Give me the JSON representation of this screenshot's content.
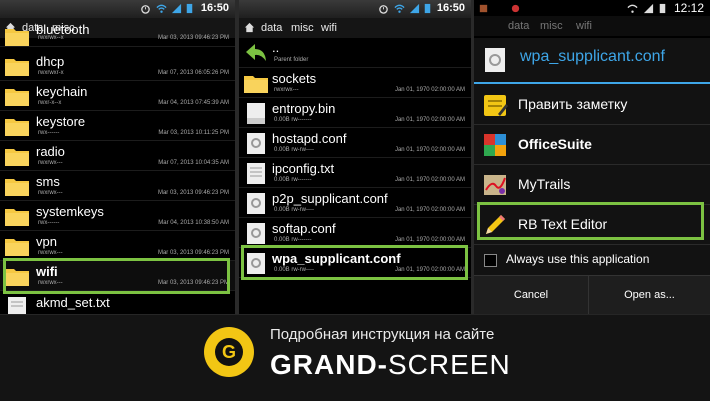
{
  "panel1": {
    "time": "16:50",
    "breadcrumbs": [
      "data",
      "misc"
    ],
    "files": [
      {
        "name": "bluetooth",
        "perm": "rwxrwx--x",
        "date": "Mar 03, 2013 09:46:23 PM"
      },
      {
        "name": "dhcp",
        "perm": "rwxrwxr-x",
        "date": "Mar 07, 2013 06:05:26 PM"
      },
      {
        "name": "keychain",
        "perm": "rwxr-x--x",
        "date": "Mar 04, 2013 07:45:39 AM"
      },
      {
        "name": "keystore",
        "perm": "rwx------",
        "date": "Mar 03, 2013 10:11:25 PM"
      },
      {
        "name": "radio",
        "perm": "rwxrwx---",
        "date": "Mar 07, 2013 10:04:35 AM"
      },
      {
        "name": "sms",
        "perm": "rwxrwx---",
        "date": "Mar 03, 2013 09:46:23 PM"
      },
      {
        "name": "systemkeys",
        "perm": "rwx------",
        "date": "Mar 04, 2013 10:38:50 AM"
      },
      {
        "name": "vpn",
        "perm": "rwxrwx---",
        "date": "Mar 03, 2013 09:46:23 PM"
      },
      {
        "name": "wifi",
        "perm": "rwxrwx---",
        "date": "Mar 03, 2013 09:46:23 PM"
      },
      {
        "name": "akmd_set.txt",
        "perm": "",
        "date": ""
      }
    ]
  },
  "panel2": {
    "time": "16:50",
    "breadcrumbs": [
      "data",
      "misc",
      "wifi"
    ],
    "parent": {
      "name": "..",
      "sub": "Parent folder"
    },
    "files": [
      {
        "name": "sockets",
        "meta": "rwxrwx---",
        "date": "Jan 01, 1970 02:00:00 AM",
        "kind": "folder"
      },
      {
        "name": "entropy.bin",
        "meta": "0.00B  rw-------",
        "date": "Jan 01, 1970 02:00:00 AM",
        "kind": "bin"
      },
      {
        "name": "hostapd.conf",
        "meta": "0.00B  rw-rw----",
        "date": "Jan 01, 1970 02:00:00 AM",
        "kind": "conf"
      },
      {
        "name": "ipconfig.txt",
        "meta": "0.00B  rw-------",
        "date": "Jan 01, 1970 02:00:00 AM",
        "kind": "txt"
      },
      {
        "name": "p2p_supplicant.conf",
        "meta": "0.00B  rw-rw----",
        "date": "Jan 01, 1970 02:00:00 AM",
        "kind": "conf"
      },
      {
        "name": "softap.conf",
        "meta": "0.00B  rw-------",
        "date": "Jan 01, 1970 02:00:00 AM",
        "kind": "conf"
      },
      {
        "name": "wpa_supplicant.conf",
        "meta": "0.00B  rw-rw----",
        "date": "Jan 01, 1970 02:00:00 AM",
        "kind": "conf"
      }
    ]
  },
  "panel3": {
    "time": "12:12",
    "breadcrumbs": [
      "data",
      "misc",
      "wifi"
    ],
    "title": "wpa_supplicant.conf",
    "options": [
      {
        "label": "Править заметку",
        "icon": "note-edit-icon"
      },
      {
        "label": "OfficeSuite",
        "icon": "officesuite-icon"
      },
      {
        "label": "MyTrails",
        "icon": "map-icon"
      },
      {
        "label": "RB Text Editor",
        "icon": "pencil-icon"
      }
    ],
    "always_label": "Always use this application",
    "cancel_label": "Cancel",
    "open_as_label": "Open as..."
  },
  "banner": {
    "logo_letter": "G",
    "subtitle": "Подробная инструкция на сайте",
    "brand_bold": "GRAND-",
    "brand_light": "SCREEN"
  },
  "colors": {
    "highlight": "#7cc242",
    "accent": "#3ea6e8",
    "logo": "#f2c614"
  }
}
